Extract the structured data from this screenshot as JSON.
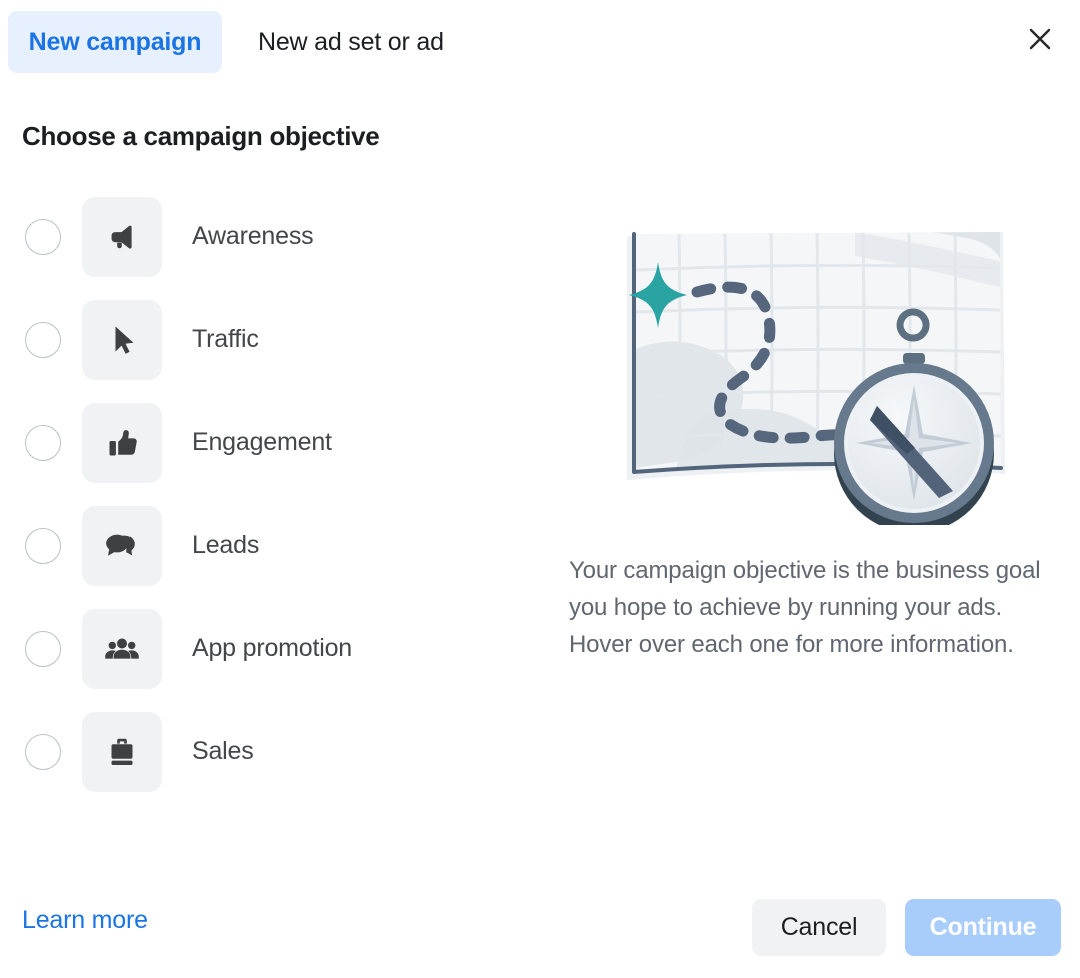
{
  "header": {
    "tabs": [
      {
        "label": "New campaign",
        "active": true
      },
      {
        "label": "New ad set or ad",
        "active": false
      }
    ],
    "close_icon": "close-icon"
  },
  "main": {
    "section_title": "Choose a campaign objective",
    "objectives": [
      {
        "label": "Awareness",
        "icon": "megaphone-icon",
        "selected": false
      },
      {
        "label": "Traffic",
        "icon": "cursor-arrow-icon",
        "selected": false
      },
      {
        "label": "Engagement",
        "icon": "thumbs-up-icon",
        "selected": false
      },
      {
        "label": "Leads",
        "icon": "speech-bubbles-icon",
        "selected": false
      },
      {
        "label": "App promotion",
        "icon": "people-group-icon",
        "selected": false
      },
      {
        "label": "Sales",
        "icon": "briefcase-icon",
        "selected": false
      }
    ]
  },
  "right_panel": {
    "illustration": "map-with-compass-illustration",
    "description": "Your campaign objective is the business goal you hope to achieve by running your ads. Hover over each one for more information."
  },
  "footer": {
    "learn_more_label": "Learn more",
    "cancel_label": "Cancel",
    "continue_label": "Continue",
    "continue_disabled": true
  },
  "colors": {
    "accent_blue": "#1b74e4",
    "tab_active_bg": "#e7f0fe",
    "continue_disabled_bg": "#a8cdfa",
    "cancel_bg": "#f1f2f3",
    "icon_tile_bg": "#f1f2f3",
    "icon_glyph": "#3e4042",
    "text_primary": "#1c1e21",
    "text_secondary": "#606770",
    "radio_border": "#bcc0c4",
    "illustration_teal": "#2aa3a3",
    "illustration_slate": "#5b6b80",
    "illustration_paper": "#f4f6f8"
  }
}
